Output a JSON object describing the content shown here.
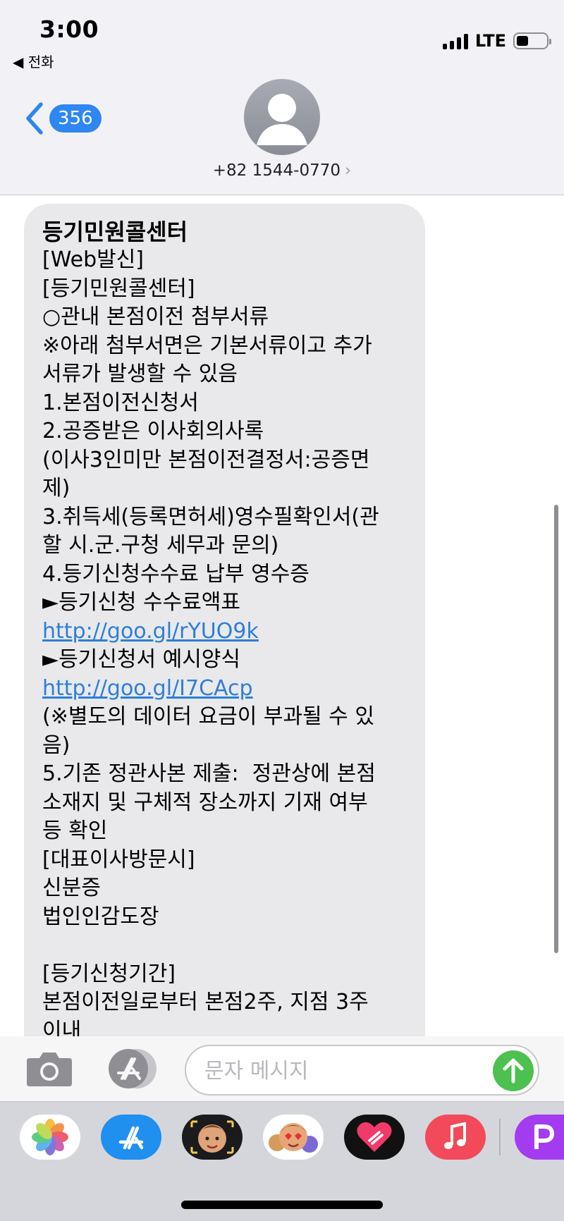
{
  "status_bar": {
    "time": "3:00",
    "back_app": "◀ 전화",
    "network": "LTE",
    "battery_level": 0.4
  },
  "header": {
    "back_badge": "356",
    "contact": "+82 1544-0770",
    "contact_chevron": "›",
    "icons": [
      "back-chevron-icon",
      "contact-avatar-icon",
      "chevron-right-icon"
    ]
  },
  "message": {
    "sender": "등기민원콜센터",
    "lines": [
      "[Web발신]",
      "[등기민원콜센터]",
      "○관내 본점이전 첨부서류",
      "※아래 첨부서면은 기본서류이고 추가",
      "서류가 발생할 수 있음",
      "1.본점이전신청서",
      "2.공증받은 이사회의사록",
      "(이사3인미만 본점이전결정서:공증면",
      "제)",
      "3.취득세(등록면허세)영수필확인서(관",
      "할 시.군.구청 세무과 문의)",
      "4.등기신청수수료 납부 영수증",
      "►등기신청 수수료액표"
    ],
    "link1": "http://goo.gl/rYUO9k",
    "line_after_link1": "►등기신청서 예시양식",
    "link2": "http://goo.gl/I7CAcp",
    "lines_after_link2": [
      "(※별도의 데이터 요금이 부과될 수 있",
      "음)",
      "5.기존 정관사본 제출:  정관상에 본점",
      "소재지 및 구체적 장소까지 기재 여부",
      "등 확인",
      "[대표이사방문시]",
      "신분증",
      "법인인감도장",
      " ",
      "[등기신청기간]",
      "본점이전일로부터 본점2주, 지점 3주",
      "이내"
    ]
  },
  "input_bar": {
    "placeholder": "문자 메시지",
    "icons": [
      "camera-icon",
      "app-store-icon",
      "send-arrow-icon"
    ]
  },
  "app_drawer": {
    "apps": [
      "photos-app-icon",
      "app-store-app-icon",
      "memoji-camera-app-icon",
      "memoji-stickers-app-icon",
      "digital-touch-app-icon",
      "music-app-icon",
      "partial-app-icon"
    ]
  },
  "colors": {
    "accent_blue": "#2e87f2",
    "link_blue": "#2e7ed9",
    "send_green": "#4cc14f",
    "bubble_gray": "#e9e9eb"
  }
}
